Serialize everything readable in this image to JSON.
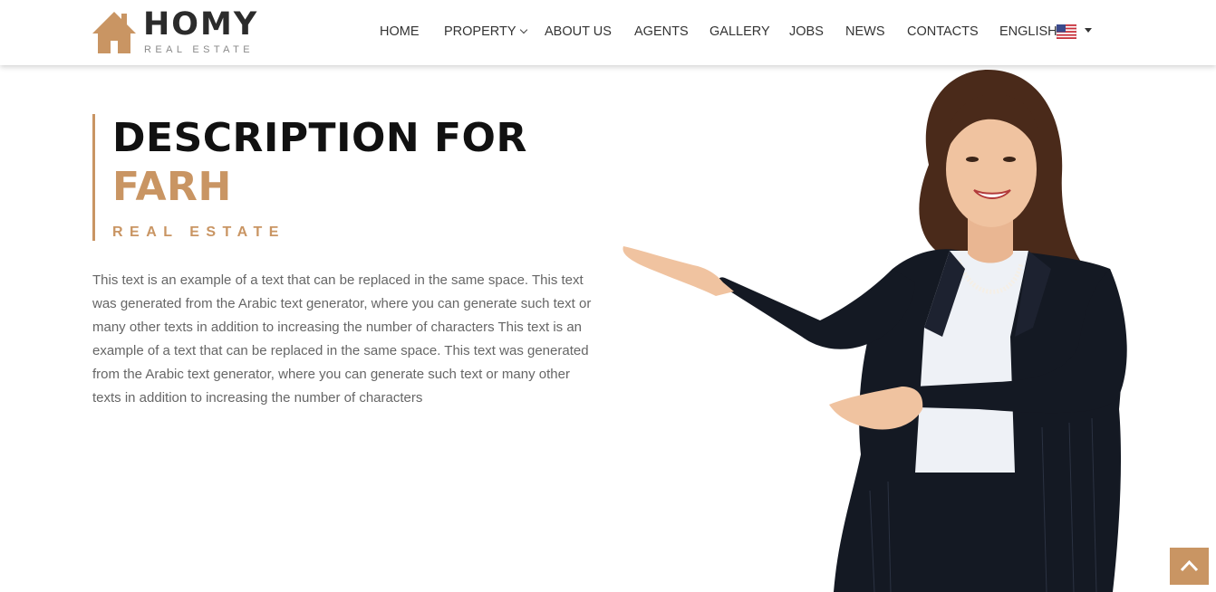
{
  "brand": {
    "name": "HOMY",
    "tagline": "REAL ESTATE",
    "accent_color": "#c99563",
    "logo_icon": "house-icon"
  },
  "nav": {
    "items": [
      {
        "label": "HOME"
      },
      {
        "label": "PROPERTY",
        "has_dropdown": true
      },
      {
        "label": "ABOUT US"
      },
      {
        "label": "AGENTS"
      },
      {
        "label": "GALLERY"
      },
      {
        "label": "JOBS"
      },
      {
        "label": "NEWS"
      },
      {
        "label": "CONTACTS"
      }
    ],
    "language": {
      "label": "ENGLISH",
      "flag_icon": "us-flag-icon",
      "caret_icon": "caret-down-icon"
    }
  },
  "hero": {
    "title_line1": "DESCRIPTION FOR",
    "title_line2": "FARH",
    "subtitle": "REAL ESTATE",
    "description": "This text is an example of a text that can be replaced in the same space. This text was generated from the Arabic text generator, where you can generate such text or many other texts in addition to increasing the number of characters This text is an example of a text that can be replaced in the same space. This text was generated from the Arabic text generator, where you can generate such text or many other texts in addition to increasing the number of characters",
    "image": "businesswoman-presenting-illustration"
  },
  "back_to_top": {
    "icon": "chevron-up-icon"
  }
}
